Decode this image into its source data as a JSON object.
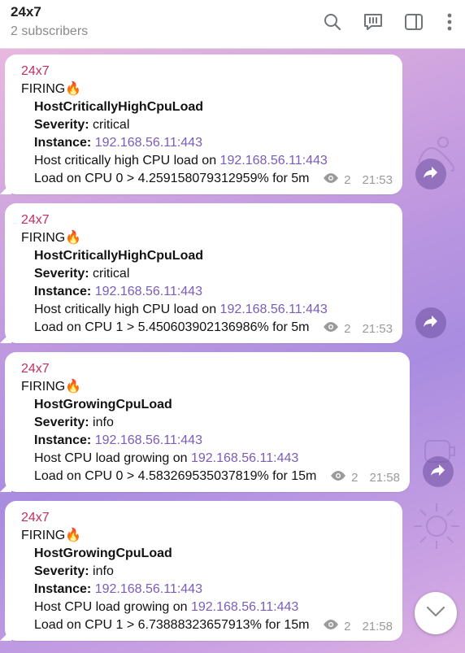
{
  "header": {
    "title": "24x7",
    "subtitle": "2 subscribers"
  },
  "messages": [
    {
      "sender": "24x7",
      "status": "FIRING🔥",
      "alertname": "HostCriticallyHighCpuLoad",
      "severity_label": "Severity:",
      "severity": "critical",
      "instance_label": "Instance:",
      "instance": "192.168.56.11:443",
      "description_prefix": "Host critically high CPU load on ",
      "description_link": "192.168.56.11:443",
      "summary": "Load on CPU 0 > 4.259158079312959% for 5m",
      "views": "2",
      "time": "21:53"
    },
    {
      "sender": "24x7",
      "status": "FIRING🔥",
      "alertname": "HostCriticallyHighCpuLoad",
      "severity_label": "Severity:",
      "severity": "critical",
      "instance_label": "Instance:",
      "instance": "192.168.56.11:443",
      "description_prefix": "Host critically high CPU load on ",
      "description_link": "192.168.56.11:443",
      "summary": "Load on CPU 1 > 5.450603902136986% for 5m",
      "views": "2",
      "time": "21:53"
    },
    {
      "sender": "24x7",
      "status": "FIRING🔥",
      "alertname": "HostGrowingCpuLoad",
      "severity_label": "Severity:",
      "severity": "info",
      "instance_label": "Instance:",
      "instance": "192.168.56.11:443",
      "description_prefix": "Host CPU load growing on ",
      "description_link": "192.168.56.11:443",
      "summary": "Load on CPU 0 > 4.583269535037819% for 15m",
      "views": "2",
      "time": "21:58"
    },
    {
      "sender": "24x7",
      "status": "FIRING🔥",
      "alertname": "HostGrowingCpuLoad",
      "severity_label": "Severity:",
      "severity": "info",
      "instance_label": "Instance:",
      "instance": "192.168.56.11:443",
      "description_prefix": "Host CPU load growing on ",
      "description_link": "192.168.56.11:443",
      "summary": "Load on CPU 1 > 6.73888323657913% for 15m",
      "views": "2",
      "time": "21:58"
    }
  ],
  "icons": {
    "search": "search-icon",
    "discussion": "comments-icon",
    "sidebar": "sidebar-toggle-icon",
    "more": "more-vertical-icon",
    "views": "eye-icon",
    "forward": "forward-arrow-icon",
    "scroll": "chevron-down-icon"
  },
  "colors": {
    "sender": "#c0305f",
    "link": "#7b5cb8",
    "meta": "#9a9a9a",
    "header_bg": "#ffffff"
  }
}
